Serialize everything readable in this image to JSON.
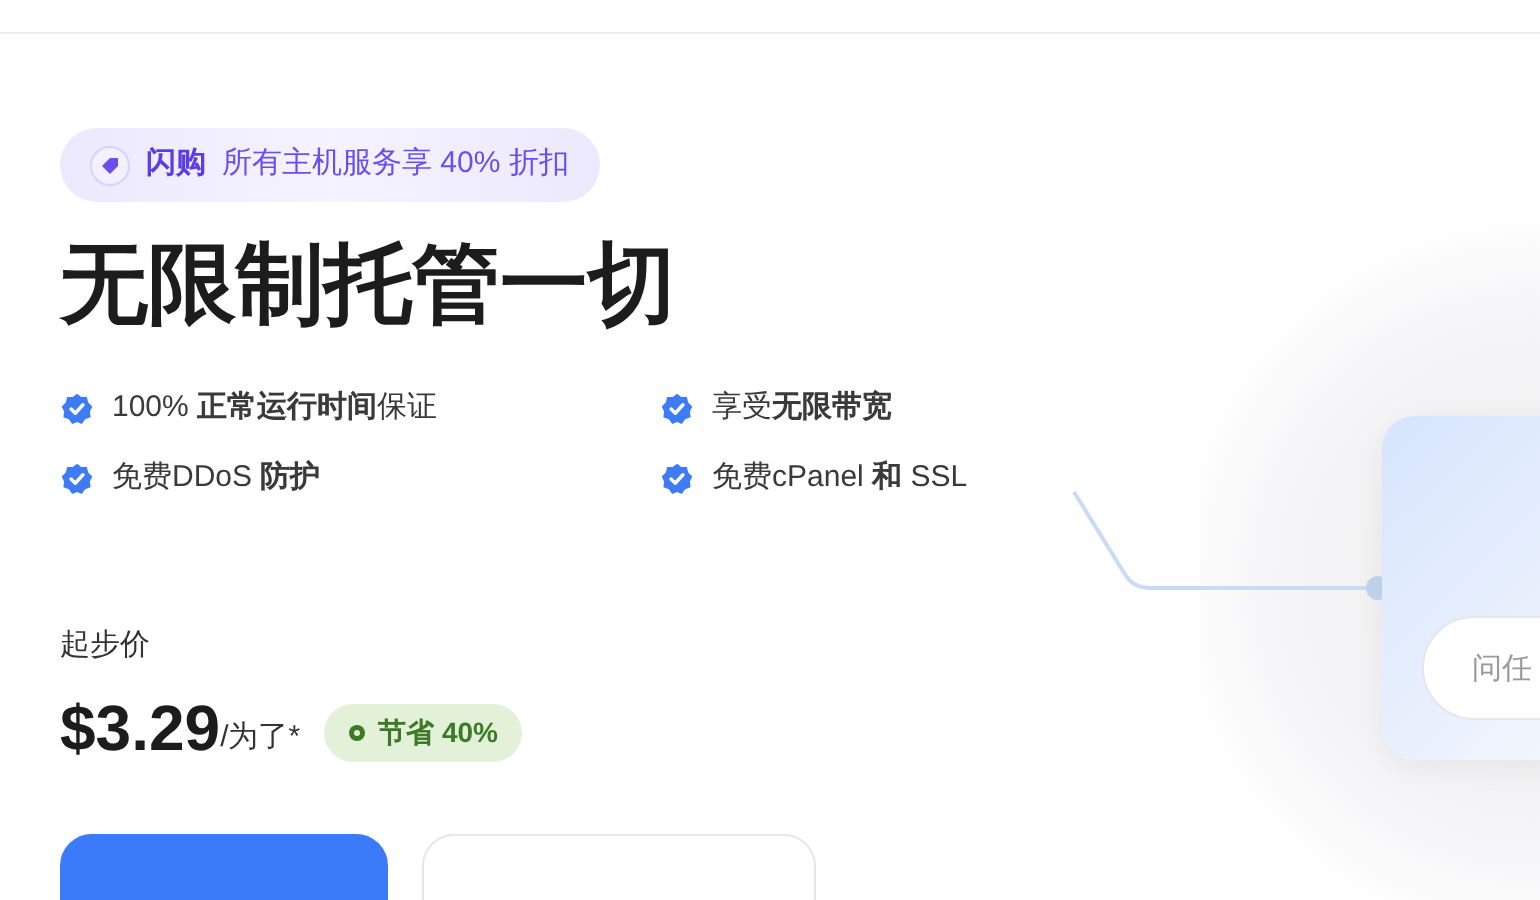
{
  "promo": {
    "label": "闪购",
    "text": "所有主机服务享 40% 折扣"
  },
  "headline": "无限制托管一切",
  "features": [
    {
      "text": "100% **正常运行时间**保证"
    },
    {
      "text": "享受**无限带宽**"
    },
    {
      "text": "免费DDoS **防护**"
    },
    {
      "text": "免费cPanel **和** SSL"
    }
  ],
  "pricing": {
    "label": "起步价",
    "price": "$3.29",
    "unit": "/为了*",
    "savings": "节省 40%"
  },
  "buttons": [
    {
      "kind": "primary"
    },
    {
      "kind": "secondary"
    }
  ],
  "chat_card": {
    "placeholder": "问任"
  }
}
